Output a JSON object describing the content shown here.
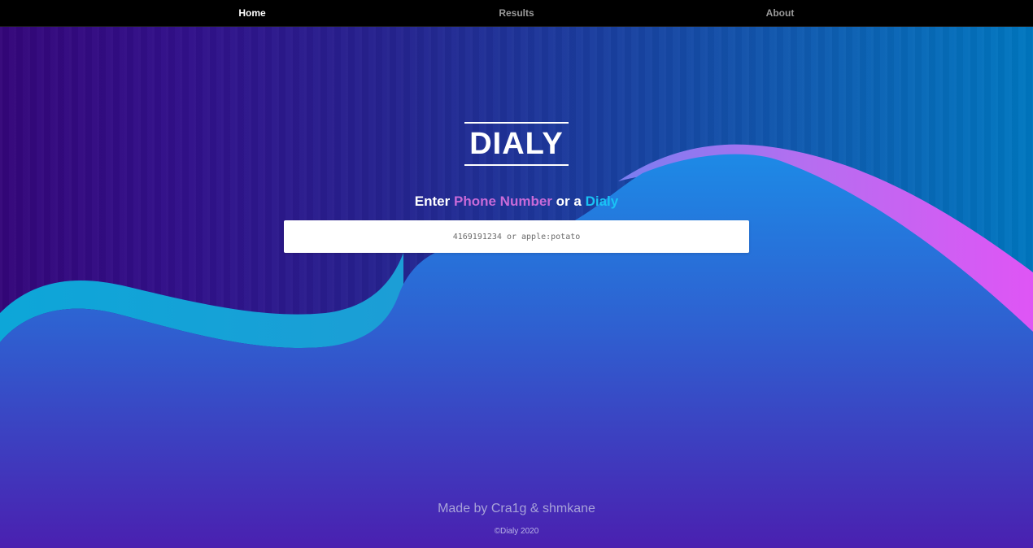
{
  "nav": {
    "items": [
      {
        "label": "Home"
      },
      {
        "label": "Results"
      },
      {
        "label": "About"
      }
    ]
  },
  "hero": {
    "logo": "DIALY",
    "prompt": {
      "prefix": "Enter",
      "highlight_phone": "Phone Number",
      "middle": "or a",
      "highlight_dialy": "Dialy"
    },
    "search": {
      "placeholder": "4169191234 or apple:potato",
      "value": ""
    }
  },
  "footer": {
    "credits": "Made by Cra1g & shmkane",
    "copyright": "©Dialy 2020"
  },
  "colors": {
    "accent_pink": "#c86ad8",
    "accent_cyan": "#19c3f5",
    "nav_background": "#000000",
    "bg_left": "#34067a",
    "bg_right": "#0077c0"
  }
}
